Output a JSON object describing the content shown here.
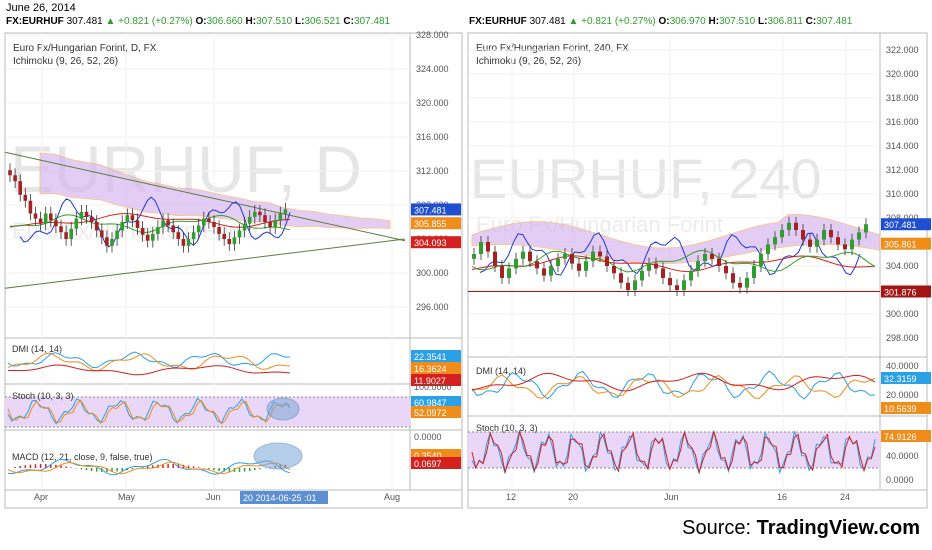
{
  "date": "June 26, 2014",
  "left": {
    "symbol": "FX:EURHUF",
    "last": "307.481",
    "change": "▲ +0.821 (+0.27%)",
    "o_label": "O:",
    "o": "306.660",
    "h_label": "H:",
    "h": "307.510",
    "l_label": "L:",
    "l": "306.521",
    "c_label": "C:",
    "c": "307.481",
    "title": "Euro Fx/Hungarian Forint, D, FX",
    "indicator": "Ichimoku (9, 26, 52, 26)",
    "watermark": "EURHUF, D",
    "watermark_sub": "Euro Fx/Hungarian Forint",
    "price_ticks": [
      "328.000",
      "324.000",
      "320.000",
      "316.000",
      "312.000",
      "308.000",
      "304.000",
      "300.000",
      "296.000"
    ],
    "price_tags": [
      {
        "text": "307.481",
        "color": "#1f4fd1"
      },
      {
        "text": "305.855",
        "color": "#f08c1a"
      },
      {
        "text": "304.093",
        "color": "#d62020"
      }
    ],
    "dmi_label": "DMI (14, 14)",
    "dmi_tags": [
      {
        "text": "22.3541",
        "color": "#2aa0e6"
      },
      {
        "text": "16.3624",
        "color": "#f08c1a"
      },
      {
        "text": "11.9027",
        "color": "#d62020"
      }
    ],
    "stoch_label": "Stoch (10, 3, 3)",
    "stoch_ticks": [
      "100.0000",
      "0.0000"
    ],
    "stoch_tags": [
      {
        "text": "60.9847",
        "color": "#2aa0e6"
      },
      {
        "text": "52.0972",
        "color": "#f08c1a"
      }
    ],
    "macd_label": "MACD (12, 21, close, 9, false, true)",
    "macd_tags": [
      {
        "text": "0.3540",
        "color": "#f08c1a"
      },
      {
        "text": "0.0697",
        "color": "#d62020"
      }
    ],
    "x_ticks": [
      "Apr",
      "May",
      "Jun",
      "Aug"
    ],
    "cursor_date": "20 2014-06-25 :01"
  },
  "right": {
    "symbol": "FX:EURHUF",
    "last": "307.481",
    "change": "▲ +0.821 (+0.27%)",
    "o_label": "O:",
    "o": "306.970",
    "h_label": "H:",
    "h": "307.510",
    "l_label": "L:",
    "l": "306.811",
    "c_label": "C:",
    "c": "307.481",
    "title": "Euro Fx/Hungarian Forint, 240, FX",
    "indicator": "Ichimoku (9, 26, 52, 26)",
    "watermark": "EURHUF, 240",
    "watermark_sub": "Euro Fx/Hungarian Forint",
    "price_ticks": [
      "322.000",
      "320.000",
      "318.000",
      "316.000",
      "314.000",
      "312.000",
      "310.000",
      "308.000",
      "306.000",
      "304.000",
      "302.000",
      "300.000",
      "298.000"
    ],
    "price_tags": [
      {
        "text": "307.481",
        "color": "#1f4fd1"
      },
      {
        "text": "305.861",
        "color": "#f08c1a"
      },
      {
        "text": "301.876",
        "color": "#a31515"
      }
    ],
    "dmi_label": "DMI (14, 14)",
    "dmi_ticks": [
      "40.0000",
      "20.0000"
    ],
    "dmi_tags": [
      {
        "text": "32.3159",
        "color": "#2aa0e6"
      },
      {
        "text": "10.5639",
        "color": "#f08c1a"
      }
    ],
    "stoch_label": "Stoch (10, 3, 3)",
    "stoch_ticks": [
      "40.0000",
      "0.0000"
    ],
    "stoch_tags": [
      {
        "text": "74.9126",
        "color": "#f08c1a"
      }
    ],
    "x_ticks": [
      "12",
      "20",
      "Jun",
      "16",
      "24"
    ]
  },
  "source": {
    "prefix": "Source: ",
    "brand": "TradingView.com"
  },
  "chart_data": [
    {
      "type": "candlestick",
      "title": "Euro Fx/Hungarian Forint, D, FX",
      "ylim": [
        294,
        329
      ],
      "x_ticks": [
        "Apr",
        "May",
        "Jun",
        "Aug"
      ],
      "close": [
        311.5,
        310.8,
        309.2,
        308.5,
        307.0,
        306.4,
        305.8,
        307.0,
        306.2,
        305.5,
        304.8,
        304.0,
        305.2,
        306.4,
        307.2,
        306.6,
        306.0,
        305.0,
        304.2,
        303.2,
        304.0,
        305.0,
        306.0,
        306.8,
        306.2,
        305.3,
        304.5,
        303.8,
        304.6,
        305.4,
        306.2,
        305.6,
        304.8,
        304.0,
        303.2,
        304.0,
        304.8,
        305.6,
        306.4,
        306.0,
        305.4,
        304.6,
        304.0,
        303.4,
        304.2,
        305.0,
        305.8,
        306.6,
        307.2,
        306.8,
        306.0,
        305.4,
        306.2,
        307.0,
        307.481
      ],
      "ichimoku_cloud_top": [
        310.5,
        310.5,
        310.0,
        309.8,
        309.6,
        309.0,
        308.5,
        308.0,
        307.8,
        307.5,
        307.5,
        307.3,
        307.0,
        306.8,
        306.5,
        306.5,
        306.0,
        305.8,
        305.8,
        305.6,
        305.5,
        305.4,
        305.4,
        305.3
      ],
      "trendlines": [
        {
          "name": "upper",
          "from": 314.2,
          "to": 303.8
        },
        {
          "name": "lower",
          "from": 298.2,
          "to": 304.0
        }
      ],
      "price_levels": [
        307.481,
        305.855,
        304.093
      ]
    },
    {
      "type": "candlestick",
      "title": "Euro Fx/Hungarian Forint, 240, FX",
      "ylim": [
        297,
        323
      ],
      "x_ticks": [
        "12",
        "20",
        "Jun",
        "16",
        "24"
      ],
      "price_levels": [
        307.481,
        305.861,
        301.876
      ],
      "close": [
        305.0,
        306.0,
        305.2,
        304.0,
        303.0,
        303.8,
        304.6,
        305.2,
        304.4,
        303.8,
        303.2,
        304.0,
        304.6,
        305.0,
        304.2,
        303.6,
        304.4,
        305.2,
        304.8,
        304.0,
        303.4,
        302.6,
        302.0,
        302.8,
        303.6,
        304.2,
        303.8,
        303.0,
        302.4,
        302.0,
        302.8,
        303.6,
        304.4,
        305.0,
        304.6,
        304.0,
        303.4,
        302.6,
        302.2,
        303.0,
        304.0,
        305.0,
        305.8,
        306.4,
        307.0,
        307.6,
        307.0,
        306.2,
        305.6,
        306.2,
        307.0,
        306.4,
        305.8,
        305.4,
        306.2,
        306.8,
        307.481
      ]
    }
  ]
}
